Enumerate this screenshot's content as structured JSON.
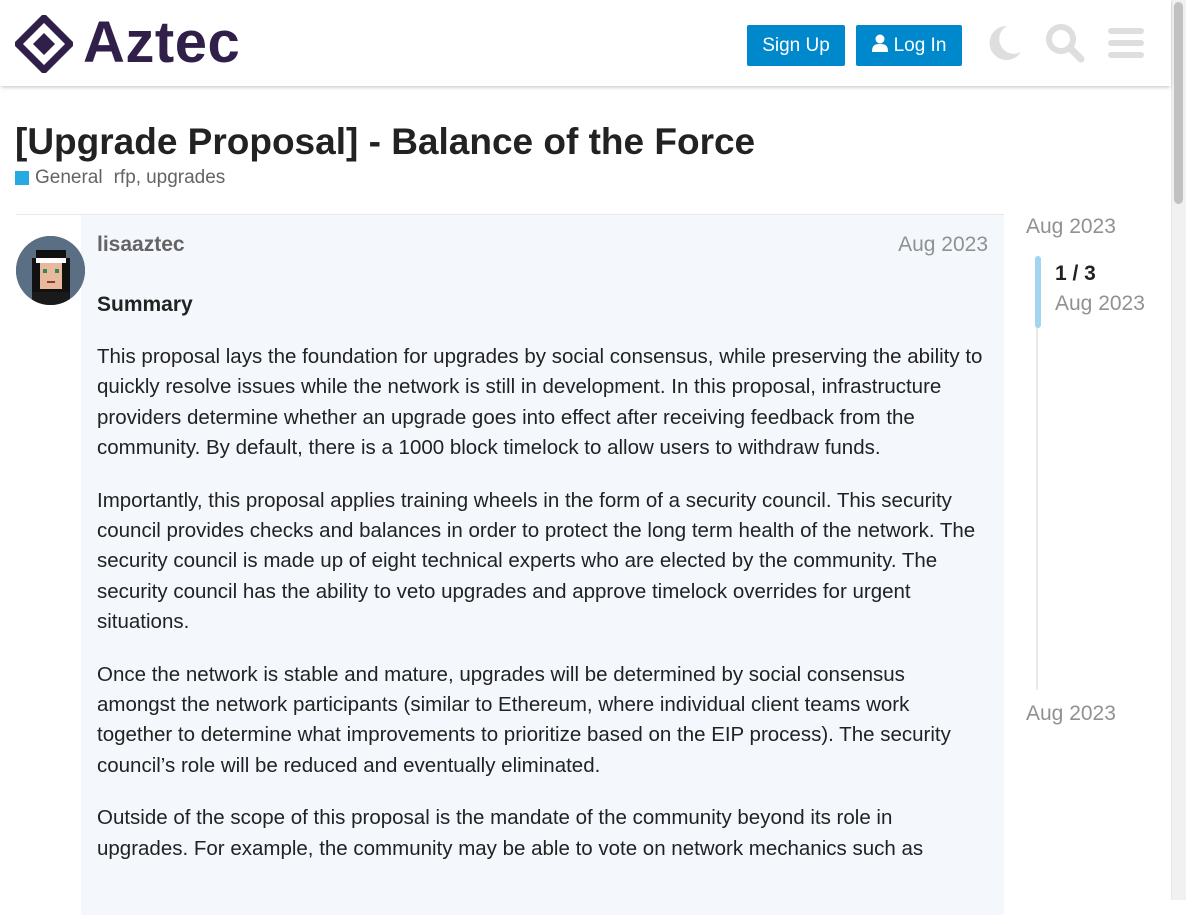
{
  "header": {
    "logo_text": "Aztec",
    "signup_label": "Sign Up",
    "login_label": "Log In",
    "icons": [
      "diamond-logo-icon",
      "user-icon",
      "moon-icon",
      "search-icon",
      "hamburger-menu-icon"
    ]
  },
  "topic": {
    "title": "[Upgrade Proposal] - Balance of the Force",
    "category": "General",
    "category_color": "#25aae1",
    "tags": [
      "rfp",
      "upgrades"
    ]
  },
  "post": {
    "username": "lisaaztec",
    "date": "Aug 2023",
    "heading": "Summary",
    "paragraphs": [
      "This proposal lays the foundation for upgrades by social consensus, while preserving the ability to quickly resolve issues while the network is still in development. In this proposal, infrastructure providers determine whether an upgrade goes into effect after receiving feedback from the community. By default, there is a 1000 block timelock to allow users to withdraw funds.",
      "Importantly, this proposal applies training wheels in the form of a security council. This security council provides checks and balances in order to protect the long term health of the network. The security council is made up of eight technical experts who are elected by the community. The security council has the ability to veto upgrades and approve timelock overrides for urgent situations.",
      "Once the network is stable and mature, upgrades will be determined by social consensus amongst the network participants (similar to Ethereum, where individual client teams work together to determine what improvements to prioritize based on the EIP process). The security council’s role will be reduced and eventually eliminated.",
      "Outside of the scope of this proposal is the mandate of the community beyond its role in upgrades. For example, the community may be able to vote on network mechanics such as"
    ]
  },
  "timeline": {
    "start_date": "Aug 2023",
    "position": "1 / 3",
    "position_date": "Aug 2023",
    "end_date": "Aug 2023"
  },
  "colors": {
    "accent": "#0088cc",
    "brand": "#2f1f49",
    "post_bg": "#f4f8fd"
  }
}
